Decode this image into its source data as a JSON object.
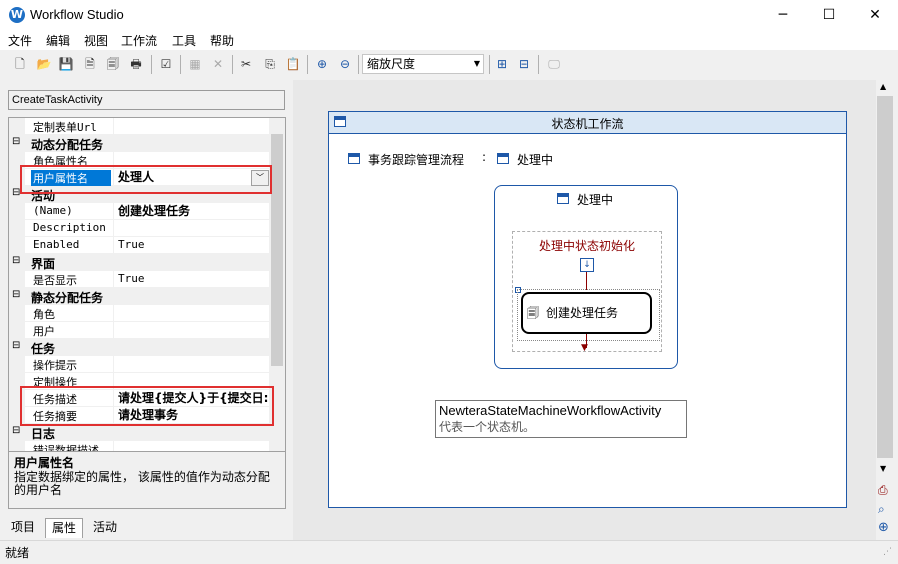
{
  "window": {
    "title": "Workflow Studio",
    "app_icon_glyph": "W",
    "minimize": "─",
    "maximize": "☐",
    "close": "✕"
  },
  "menu": [
    "文件",
    "编辑",
    "视图",
    "工作流",
    "工具",
    "帮助"
  ],
  "toolbar": {
    "zoom_label": "缩放尺度"
  },
  "left": {
    "object_selector": "CreateTaskActivity",
    "properties": [
      {
        "kind": "prop",
        "name": "定制表单Url",
        "value": ""
      },
      {
        "kind": "cat",
        "name": "动态分配任务"
      },
      {
        "kind": "prop",
        "name": "角色属性名",
        "value": ""
      },
      {
        "kind": "prop",
        "name": "用户属性名",
        "value": "处理人",
        "selected": true
      },
      {
        "kind": "cat",
        "name": "活动"
      },
      {
        "kind": "prop",
        "name": "(Name)",
        "value": "创建处理任务",
        "bold": true
      },
      {
        "kind": "prop",
        "name": "Description",
        "value": ""
      },
      {
        "kind": "prop",
        "name": "Enabled",
        "value": "True"
      },
      {
        "kind": "cat",
        "name": "界面"
      },
      {
        "kind": "prop",
        "name": "是否显示",
        "value": "True"
      },
      {
        "kind": "cat",
        "name": "静态分配任务"
      },
      {
        "kind": "prop",
        "name": "角色",
        "value": ""
      },
      {
        "kind": "prop",
        "name": "用户",
        "value": ""
      },
      {
        "kind": "cat",
        "name": "任务"
      },
      {
        "kind": "prop",
        "name": "操作提示",
        "value": ""
      },
      {
        "kind": "prop",
        "name": "定制操作",
        "value": ""
      },
      {
        "kind": "prop",
        "name": "任务描述",
        "value": "请处理{提交人}于{提交日:",
        "bold": true
      },
      {
        "kind": "prop",
        "name": "任务摘要",
        "value": "请处理事务",
        "bold": true
      },
      {
        "kind": "cat",
        "name": "日志"
      },
      {
        "kind": "prop",
        "name": "错误数据描述",
        "value": ""
      }
    ],
    "description_title": "用户属性名",
    "description_text": "指定数据绑定的属性， 该属性的值作为动态分配的用户名",
    "tabs": [
      "项目",
      "属性",
      "活动"
    ],
    "active_tab": "属性"
  },
  "designer": {
    "title": "状态机工作流",
    "workflow_name": "事务跟踪管理流程",
    "separator": ":",
    "initial_state": "处理中",
    "state_title": "处理中",
    "init_activity": "处理中状态初始化",
    "task_activity": "创建处理任务",
    "tooltip_title": "NewteraStateMachineWorkflowActivity",
    "tooltip_text": "代表一个状态机。"
  },
  "status": {
    "text": "就绪"
  }
}
